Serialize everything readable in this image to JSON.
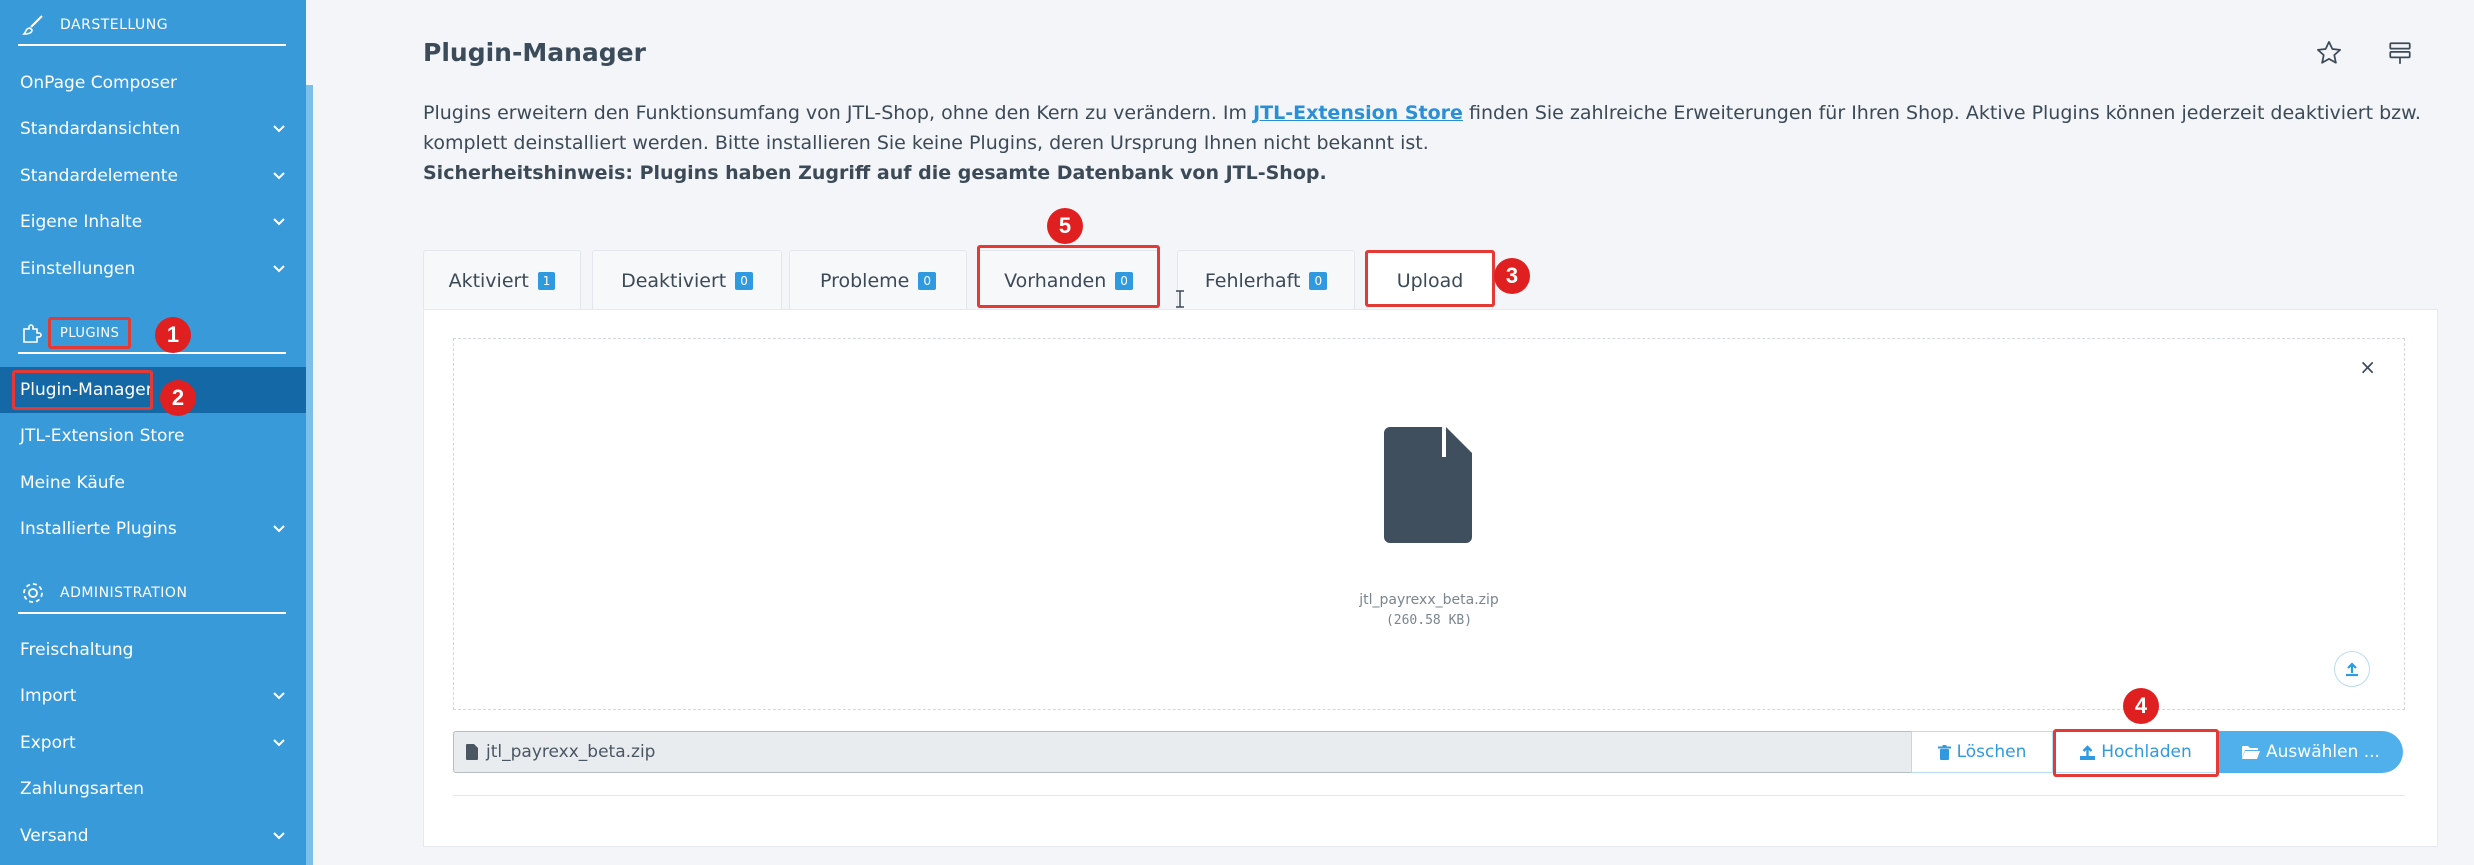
{
  "sidebar": {
    "sections": [
      {
        "label": "DARSTELLUNG",
        "icon": "paintbrush-icon"
      },
      {
        "label": "PLUGINS",
        "icon": "puzzle-icon"
      },
      {
        "label": "ADMINISTRATION",
        "icon": "gear-icon"
      }
    ],
    "items": [
      {
        "label": "OnPage Composer"
      },
      {
        "label": "Standardansichten"
      },
      {
        "label": "Standardelemente"
      },
      {
        "label": "Eigene Inhalte"
      },
      {
        "label": "Einstellungen"
      },
      {
        "label": "Plugin-Manager"
      },
      {
        "label": "JTL-Extension Store"
      },
      {
        "label": "Meine Käufe"
      },
      {
        "label": "Installierte Plugins"
      },
      {
        "label": "Freischaltung"
      },
      {
        "label": "Import"
      },
      {
        "label": "Export"
      },
      {
        "label": "Zahlungsarten"
      },
      {
        "label": "Versand"
      }
    ]
  },
  "header": {
    "title": "Plugin-Manager",
    "icons": [
      "star-icon",
      "settings-list-icon"
    ]
  },
  "intro": {
    "text_before": "Plugins erweitern den Funktionsumfang von JTL-Shop, ohne den Kern zu verändern. Im ",
    "link": "JTL-Extension Store",
    "text_after": " finden Sie zahlreiche Erweiterungen für Ihren Shop. Aktive Plugins können jederzeit deaktiviert bzw. komplett deinstalliert werden. Bitte installieren Sie keine Plugins, deren Ursprung Ihnen nicht bekannt ist.",
    "warning": "Sicherheitshinweis: Plugins haben Zugriff auf die gesamte Datenbank von JTL-Shop."
  },
  "tabs": [
    {
      "label": "Aktiviert",
      "count": "1"
    },
    {
      "label": "Deaktiviert",
      "count": "0"
    },
    {
      "label": "Probleme",
      "count": "0"
    },
    {
      "label": "Vorhanden",
      "count": "0"
    },
    {
      "label": "Fehlerhaft",
      "count": "0"
    },
    {
      "label": "Upload",
      "count": ""
    }
  ],
  "upload": {
    "close": "×",
    "file_name": "jtl_payrexx_beta.zip",
    "file_size": "(260.58 KB)",
    "input_value": "jtl_payrexx_beta.zip",
    "delete_label": "Löschen",
    "upload_label": "Hochladen",
    "select_label": "Auswählen ..."
  },
  "annotations": [
    "1",
    "2",
    "3",
    "4",
    "5"
  ],
  "colors": {
    "sidebar": "#389ad8",
    "sidebar_active": "#1568a6",
    "accent": "#2f9ae0",
    "annotation": "#e02020"
  }
}
